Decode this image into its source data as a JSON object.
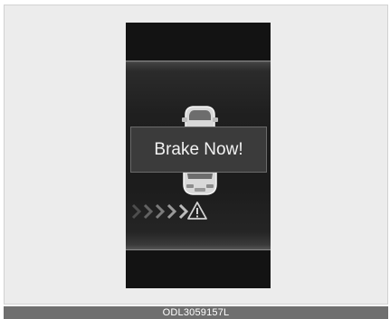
{
  "alert": {
    "message": "Brake Now!"
  },
  "icons": {
    "vehicle_ahead": "car-rear-icon",
    "own_vehicle": "car-front-icon",
    "approach": "chevrons-right-icon",
    "warning": "warning-triangle-icon"
  },
  "caption": {
    "code": "ODL3059157L"
  },
  "colors": {
    "display_background": "#131313",
    "message_box": "#3b3b3b",
    "caption_bar": "#6f6f6f",
    "text": "#f2f2f2"
  }
}
